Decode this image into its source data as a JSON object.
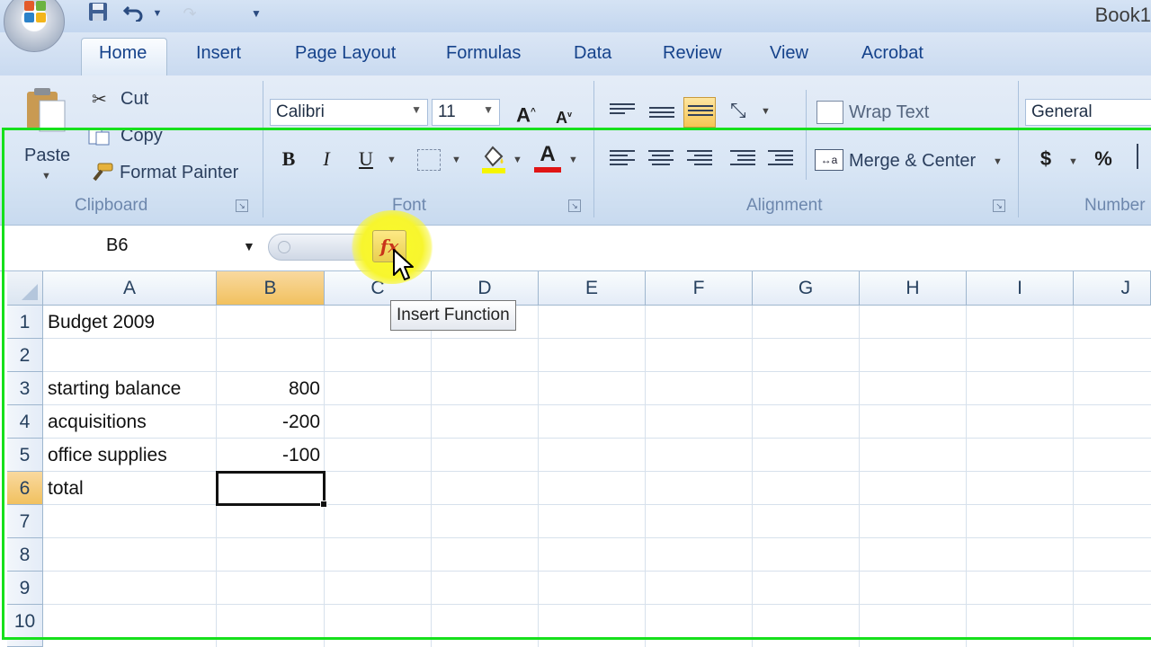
{
  "window": {
    "title": "Book1"
  },
  "tabs": [
    {
      "label": "Home"
    },
    {
      "label": "Insert"
    },
    {
      "label": "Page Layout"
    },
    {
      "label": "Formulas"
    },
    {
      "label": "Data"
    },
    {
      "label": "Review"
    },
    {
      "label": "View"
    },
    {
      "label": "Acrobat"
    }
  ],
  "clipboard": {
    "paste": "Paste",
    "cut": "Cut",
    "copy": "Copy",
    "format_painter": "Format Painter",
    "label": "Clipboard"
  },
  "font": {
    "name": "Calibri",
    "size": "11",
    "bold": "B",
    "italic": "I",
    "underline": "U",
    "font_color": "A",
    "label": "Font"
  },
  "alignment": {
    "wrap_text": "Wrap Text",
    "merge_center": "Merge & Center",
    "label": "Alignment"
  },
  "number": {
    "format": "General",
    "currency": "$",
    "percent": "%",
    "label": "Number"
  },
  "formula_bar": {
    "name_box": "B6",
    "fx": "fx"
  },
  "tooltip": "Insert Function",
  "columns": [
    "A",
    "B",
    "C",
    "D",
    "E",
    "F",
    "G",
    "H",
    "I",
    "J"
  ],
  "rows": [
    "1",
    "2",
    "3",
    "4",
    "5",
    "6",
    "7",
    "8",
    "9",
    "10"
  ],
  "cells": {
    "A1": "Budget 2009",
    "A3": "starting balance",
    "B3": "800",
    "A4": "acquisitions",
    "B4": "-200",
    "A5": "office supplies",
    "B5": "-100",
    "A6": "total"
  },
  "colors": {
    "accent_green": "#16e01c",
    "selection_header": "#f1c15f",
    "fx_highlight": "#fbfb2a"
  }
}
